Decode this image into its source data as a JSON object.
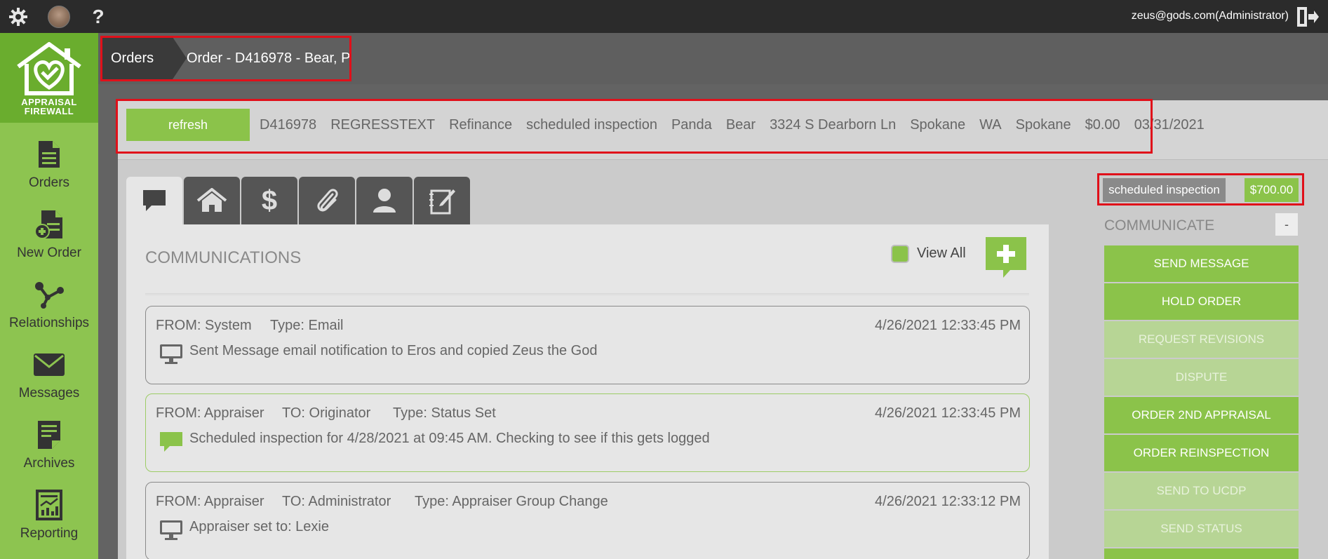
{
  "topbar": {
    "user_email": "zeus@gods.com(Administrator)",
    "icons": [
      "gear-icon",
      "avatar",
      "help-icon",
      "logout-icon"
    ]
  },
  "sidebar": {
    "logo_line1": "APPRAISAL",
    "logo_line2": "FIREWALL",
    "items": [
      {
        "label": "Orders",
        "icon": "document-icon"
      },
      {
        "label": "New Order",
        "icon": "new-order-icon"
      },
      {
        "label": "Relationships",
        "icon": "relationships-icon"
      },
      {
        "label": "Messages",
        "icon": "envelope-icon"
      },
      {
        "label": "Archives",
        "icon": "archive-icon"
      },
      {
        "label": "Reporting",
        "icon": "report-icon"
      }
    ]
  },
  "breadcrumb": {
    "root": "Orders",
    "current": "Order - D416978 - Bear, P"
  },
  "infobar": {
    "refresh_label": "refresh",
    "order_id": "D416978",
    "client": "REGRESSTEXT",
    "loan_purpose": "Refinance",
    "status": "scheduled inspection",
    "first_name": "Panda",
    "last_name": "Bear",
    "address": "3324 S Dearborn Ln",
    "city": "Spokane",
    "state": "WA",
    "county": "Spokane",
    "amount": "$0.00",
    "date": "03/31/2021"
  },
  "tabs": [
    "chat-icon",
    "home-icon",
    "dollar-icon",
    "paperclip-icon",
    "person-icon",
    "notes-icon"
  ],
  "communications": {
    "title": "COMMUNICATIONS",
    "view_all_label": "View All",
    "messages": [
      {
        "from": "FROM: System",
        "to": "",
        "type": "Type: Email",
        "date": "4/26/2021 12:33:45 PM",
        "body": "Sent Message email notification to Eros and copied Zeus the God",
        "icon": "monitor-icon"
      },
      {
        "from": "FROM: Appraiser",
        "to": "TO: Originator",
        "type": "Type: Status Set",
        "date": "4/26/2021 12:33:45 PM",
        "body": "Scheduled inspection for 4/28/2021 at 09:45 AM. Checking to see if this gets logged",
        "icon": "chat-icon"
      },
      {
        "from": "FROM: Appraiser",
        "to": "TO: Administrator",
        "type": "Type: Appraiser Group Change",
        "date": "4/26/2021 12:33:12 PM",
        "body": "Appraiser set to: Lexie",
        "icon": "monitor-icon"
      }
    ]
  },
  "right_panel": {
    "status": "scheduled inspection",
    "price": "$700.00",
    "communicate_label": "COMMUNICATE",
    "collapse_label": "-",
    "actions": [
      {
        "label": "SEND MESSAGE",
        "enabled": true
      },
      {
        "label": "HOLD ORDER",
        "enabled": true
      },
      {
        "label": "REQUEST REVISIONS",
        "enabled": false
      },
      {
        "label": "DISPUTE",
        "enabled": false
      },
      {
        "label": "ORDER 2ND APPRAISAL",
        "enabled": true
      },
      {
        "label": "ORDER REINSPECTION",
        "enabled": true
      },
      {
        "label": "SEND TO UCDP",
        "enabled": false
      },
      {
        "label": "SEND STATUS",
        "enabled": false
      }
    ]
  },
  "colors": {
    "accent_green": "#8bc34a",
    "logo_green": "#6aad2e",
    "highlight_red": "#e0101a"
  }
}
